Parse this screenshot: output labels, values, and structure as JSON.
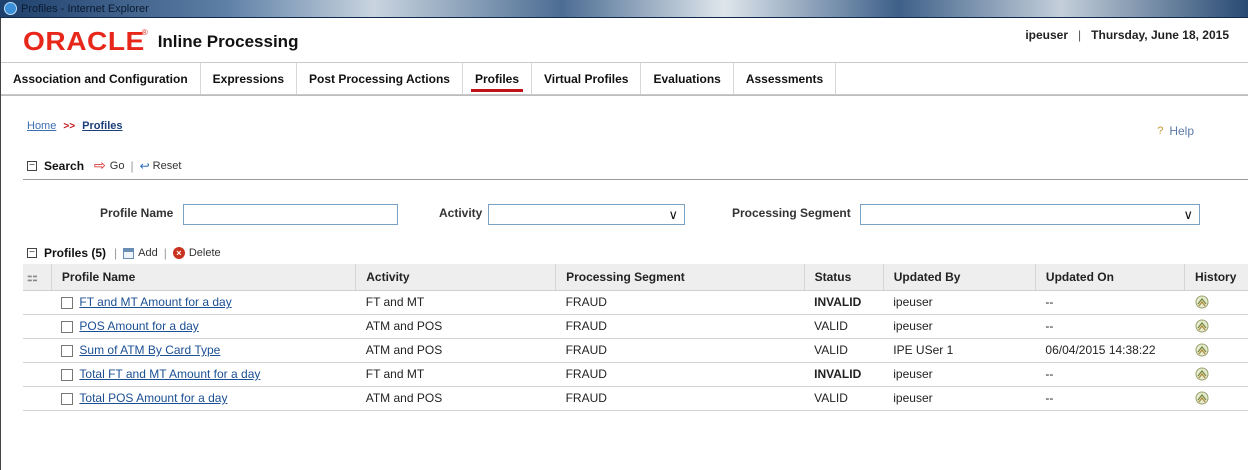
{
  "window": {
    "title": "Profiles - Internet Explorer"
  },
  "header": {
    "logo": "ORACLE",
    "logo_mark": "®",
    "product": "Inline Processing",
    "user": "ipeuser",
    "separator": "|",
    "date": "Thursday, June 18, 2015"
  },
  "tabs": [
    {
      "label": "Association and Configuration"
    },
    {
      "label": "Expressions"
    },
    {
      "label": "Post Processing Actions"
    },
    {
      "label": "Profiles",
      "active": true
    },
    {
      "label": "Virtual Profiles"
    },
    {
      "label": "Evaluations"
    },
    {
      "label": "Assessments"
    }
  ],
  "breadcrumb": {
    "home": "Home",
    "separator": ">>",
    "current": "Profiles"
  },
  "help": {
    "icon": "help-icon",
    "label": "Help"
  },
  "search": {
    "toggle": "⊟",
    "title": "Search",
    "go_label": "Go",
    "reset_label": "Reset",
    "fields": {
      "profile_name_label": "Profile Name",
      "profile_name_value": "",
      "activity_label": "Activity",
      "activity_value": "",
      "segment_label": "Processing Segment",
      "segment_value": ""
    }
  },
  "profiles": {
    "toggle": "⊟",
    "title": "Profiles (5)",
    "add_label": "Add",
    "delete_label": "Delete",
    "columns": [
      "Profile Name",
      "Activity",
      "Processing Segment",
      "Status",
      "Updated By",
      "Updated On",
      "History"
    ],
    "rows": [
      {
        "name": "FT and MT Amount for a day",
        "activity": "FT and MT",
        "segment": "FRAUD",
        "status": "INVALID",
        "updated_by": "ipeuser",
        "updated_on": "--"
      },
      {
        "name": "POS Amount for a day",
        "activity": "ATM and POS",
        "segment": "FRAUD",
        "status": "VALID",
        "updated_by": "ipeuser",
        "updated_on": "--"
      },
      {
        "name": "Sum of ATM By Card Type",
        "activity": "ATM and POS",
        "segment": "FRAUD",
        "status": "VALID",
        "updated_by": "IPE USer 1",
        "updated_on": "06/04/2015 14:38:22"
      },
      {
        "name": "Total FT and MT Amount for a day",
        "activity": "FT and MT",
        "segment": "FRAUD",
        "status": "INVALID",
        "updated_by": "ipeuser",
        "updated_on": "--"
      },
      {
        "name": "Total POS Amount for a day",
        "activity": "ATM and POS",
        "segment": "FRAUD",
        "status": "VALID",
        "updated_by": "ipeuser",
        "updated_on": "--"
      }
    ]
  },
  "colors": {
    "brand": "#e8271b",
    "accent": "#c1121c",
    "link": "#1b4f93"
  }
}
